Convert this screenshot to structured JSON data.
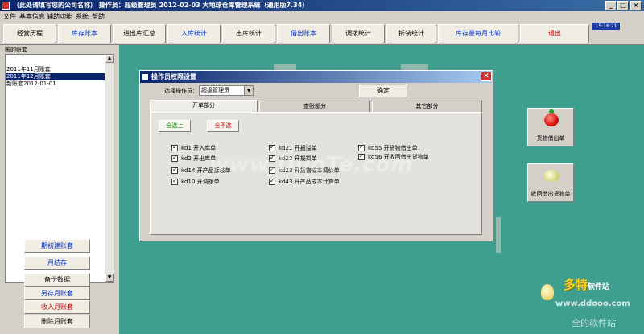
{
  "window": {
    "title": "（此处请填写您的公司名称）    操作员：超级管理员    2012-02-03    大地球仓库管理系统（通用版7.34）",
    "clock": "15:16:21"
  },
  "menu": [
    "文件",
    "基本信息",
    "辅助功能",
    "系统",
    "帮助"
  ],
  "toolbar": [
    {
      "label": "经营历程",
      "color": "black"
    },
    {
      "label": "库存账本",
      "color": "blue"
    },
    {
      "label": "进出库汇总",
      "color": "black"
    },
    {
      "label": "入库统计",
      "color": "blue"
    },
    {
      "label": "出库统计",
      "color": "black"
    },
    {
      "label": "借出账本",
      "color": "blue"
    },
    {
      "label": "调拨统计",
      "color": "black"
    },
    {
      "label": "拆装统计",
      "color": "black"
    },
    {
      "label": "库存量每月比较",
      "color": "blue"
    },
    {
      "label": "退出",
      "color": "red"
    }
  ],
  "accounts": {
    "label": "賬的账套",
    "items": [
      "2011年11月账套",
      "2011年12月账套",
      "新账套2012-01-01"
    ],
    "selected_index": 1
  },
  "left_buttons": [
    {
      "label": "期初建账套",
      "color": "blue"
    },
    {
      "label": "月结存",
      "color": "blue"
    },
    {
      "label": "备份数据",
      "color": "black"
    },
    {
      "label": "另存月账套",
      "color": "blue"
    },
    {
      "label": "收入月账套",
      "color": "red"
    },
    {
      "label": "删除月账套",
      "color": "black"
    }
  ],
  "shortcuts": {
    "lend": {
      "label": "货物借出单",
      "icon": "apple-icon"
    },
    "return": {
      "label": "收回借出货物单",
      "icon": "cabbage-icon"
    }
  },
  "dialog": {
    "title": "操作员权限设置",
    "operator_label": "选择操作员：",
    "operator_value": "超级管理员",
    "ok_label": "确定",
    "close_label": "✕",
    "tabs": [
      "开单部分",
      "查账部分",
      "其它部分"
    ],
    "active_tab": 0,
    "select_all": "全选上",
    "select_none": "全不选",
    "permissions": {
      "col1": [
        "kd1  开入库单",
        "kd2  开出库单",
        "kd14  开产品拆装单",
        "kd10  开调拨单"
      ],
      "col2": [
        "kd21  开报溢单",
        "kd22  开报损单",
        "kd23  开货物成本调价单",
        "kd43  开产品成本计算单"
      ],
      "col3": [
        "kd55  开货物借出单",
        "kd56  开收回借出货物单"
      ]
    }
  },
  "watermark": "www.DuoTe.com",
  "logos": {
    "brand": "多特",
    "brand_sub": "软件站",
    "url": "www.ddooo.com",
    "slogan": "全的软件站"
  },
  "colors": {
    "desktop": "#3f9f8f",
    "titlebar": "#0a246a",
    "blue_text": "#0033cc",
    "red_text": "#cc0000",
    "green_text": "#008800"
  }
}
